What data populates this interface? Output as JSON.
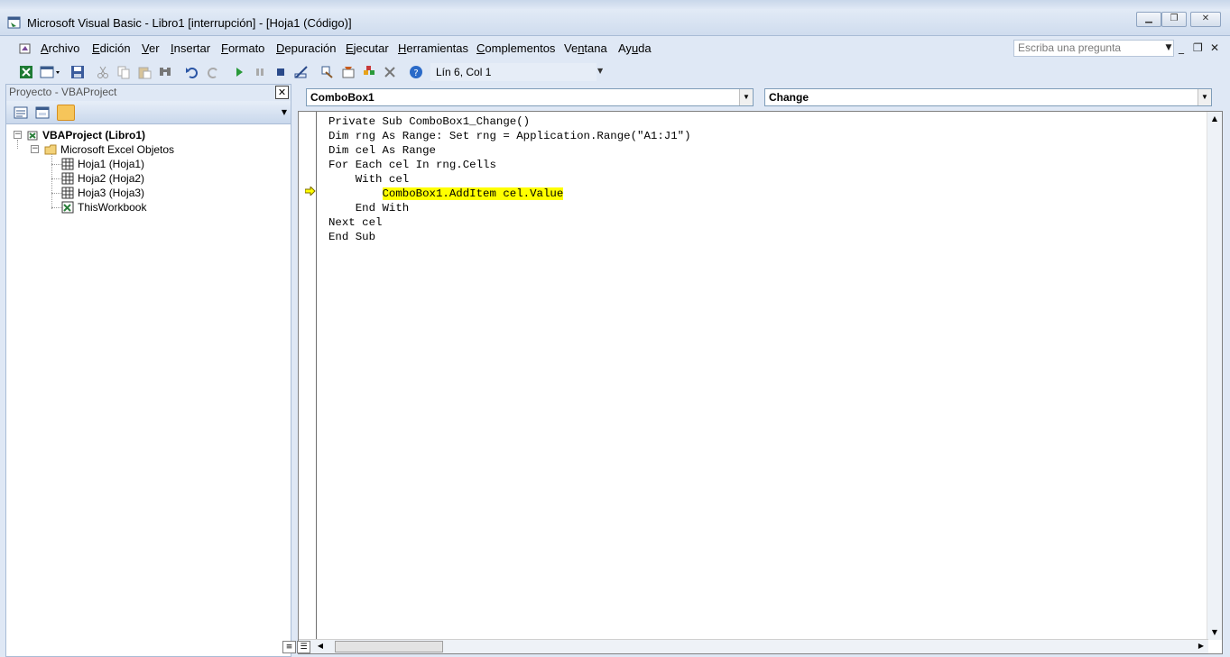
{
  "window": {
    "title": "Microsoft Visual Basic - Libro1 [interrupción] - [Hoja1 (Código)]",
    "caption_buttons": [
      "minimize",
      "restore",
      "close"
    ]
  },
  "menu": {
    "items": [
      {
        "label": "Archivo"
      },
      {
        "label": "Edición"
      },
      {
        "label": "Ver"
      },
      {
        "label": "Insertar"
      },
      {
        "label": "Formato"
      },
      {
        "label": "Depuración"
      },
      {
        "label": "Ejecutar"
      },
      {
        "label": "Herramientas"
      },
      {
        "label": "Complementos"
      },
      {
        "label": "Ventana"
      },
      {
        "label": "Ayuda"
      }
    ],
    "ask_placeholder": "Escriba una pregunta"
  },
  "toolbar": {
    "position_label": "Lín 6, Col 1",
    "icons": [
      "excel-icon",
      "insert-userform-icon",
      "save-icon",
      "cut-icon",
      "copy-icon",
      "paste-icon",
      "find-icon",
      "undo-icon",
      "redo-icon",
      "run-icon",
      "break-icon",
      "reset-icon",
      "design-mode-icon",
      "project-explorer-icon",
      "properties-icon",
      "object-browser-icon",
      "toolbox-icon",
      "help-icon"
    ]
  },
  "project": {
    "title": "Proyecto - VBAProject",
    "tree": {
      "root": "VBAProject (Libro1)",
      "folder": "Microsoft Excel Objetos",
      "items": [
        "Hoja1 (Hoja1)",
        "Hoja2 (Hoja2)",
        "Hoja3 (Hoja3)",
        "ThisWorkbook"
      ]
    }
  },
  "code": {
    "object_combo": "ComboBox1",
    "procedure_combo": "Change",
    "lines": [
      {
        "indent": "",
        "text": "Private Sub ComboBox1_Change()",
        "highlight": false
      },
      {
        "indent": "",
        "text": "Dim rng As Range: Set rng = Application.Range(\"A1:J1\")",
        "highlight": false
      },
      {
        "indent": "",
        "text": "Dim cel As Range",
        "highlight": false
      },
      {
        "indent": "",
        "text": "For Each cel In rng.Cells",
        "highlight": false
      },
      {
        "indent": "    ",
        "text": "With cel",
        "highlight": false
      },
      {
        "indent": "        ",
        "text": "ComboBox1.AddItem cel.Value",
        "highlight": true
      },
      {
        "indent": "    ",
        "text": "End With",
        "highlight": false
      },
      {
        "indent": "",
        "text": "Next cel",
        "highlight": false
      },
      {
        "indent": "",
        "text": "End Sub",
        "highlight": false
      }
    ],
    "execution_line": 6,
    "highlight_color": "#ffff00"
  }
}
